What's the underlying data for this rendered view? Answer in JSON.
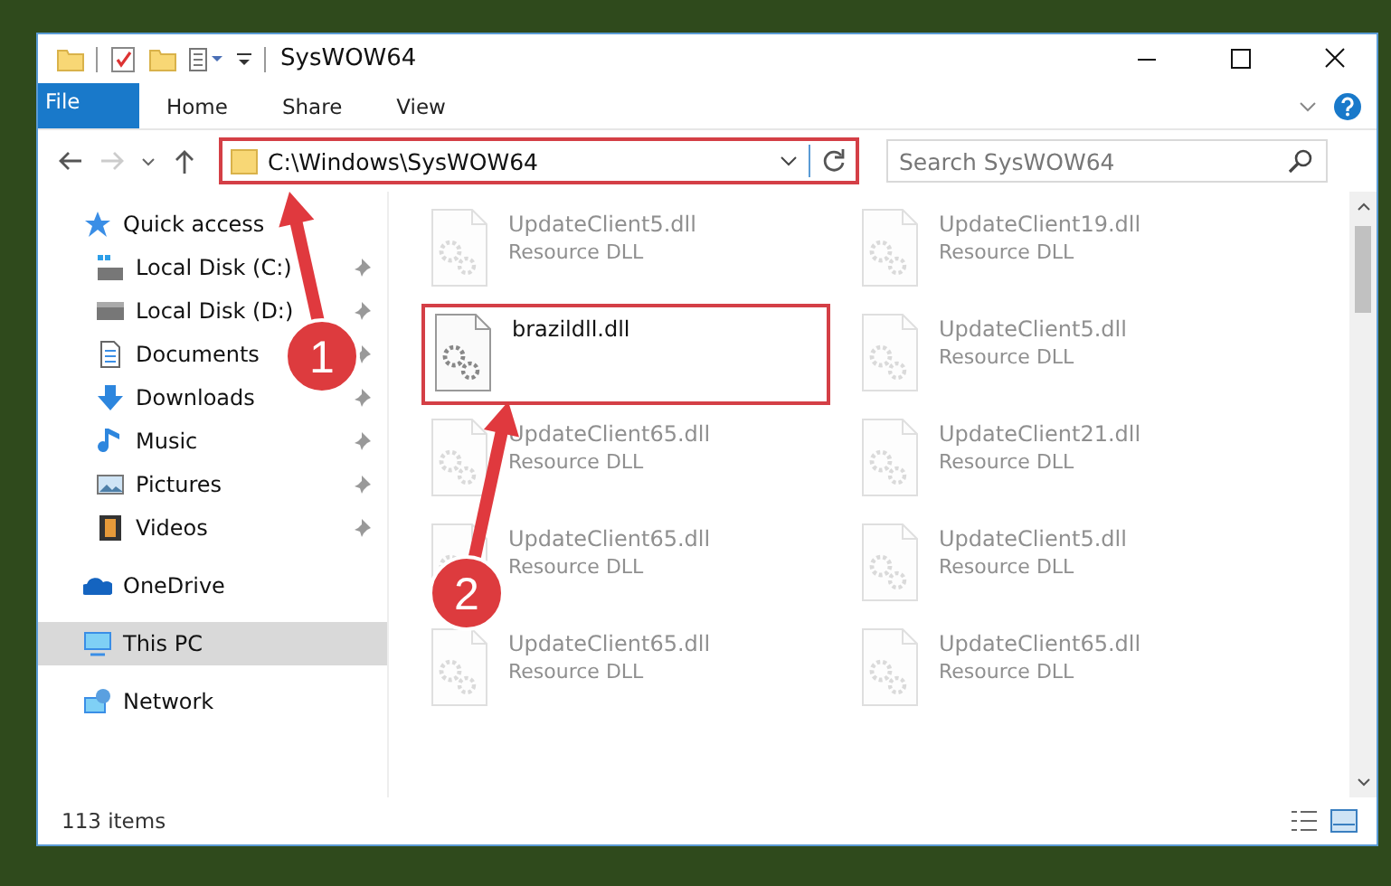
{
  "window": {
    "title": "SysWOW64"
  },
  "ribbon_tabs": [
    {
      "label": "File",
      "kind": "file"
    },
    {
      "label": "Home",
      "kind": "tab"
    },
    {
      "label": "Share",
      "kind": "tab"
    },
    {
      "label": "View",
      "kind": "tab"
    }
  ],
  "address_bar": {
    "path": "C:\\Windows\\SysWOW64",
    "highlighted": true
  },
  "search": {
    "placeholder": "Search SysWOW64"
  },
  "sidebar": {
    "items": [
      {
        "label": "Quick access",
        "selected": false,
        "children": [
          {
            "label": "Local Disk (C:)",
            "pinned": true
          },
          {
            "label": "Local Disk (D:)",
            "pinned": true
          },
          {
            "label": "Documents",
            "pinned": true
          },
          {
            "label": "Downloads",
            "pinned": true
          },
          {
            "label": "Music",
            "pinned": true
          },
          {
            "label": "Pictures",
            "pinned": true
          },
          {
            "label": "Videos",
            "pinned": true
          }
        ]
      },
      {
        "label": "OneDrive",
        "selected": false
      },
      {
        "label": "This PC",
        "selected": true
      },
      {
        "label": "Network",
        "selected": false
      }
    ]
  },
  "files": [
    {
      "name": "UpdateClient5.dll",
      "type": "Resource DLL",
      "kind": "faded"
    },
    {
      "name": "UpdateClient19.dll",
      "type": "Resource DLL",
      "kind": "faded"
    },
    {
      "name": "brazildll.dll",
      "kind": "highlighted"
    },
    {
      "name": "UpdateClient5.dll",
      "type": "Resource DLL",
      "kind": "faded"
    },
    {
      "name": "UpdateClient65.dll",
      "type": "Resource DLL",
      "kind": "faded"
    },
    {
      "name": "UpdateClient21.dll",
      "type": "Resource DLL",
      "kind": "faded"
    },
    {
      "name": "UpdateClient65.dll",
      "type": "Resource DLL",
      "kind": "faded"
    },
    {
      "name": "UpdateClient5.dll",
      "type": "Resource DLL",
      "kind": "faded"
    },
    {
      "name": "UpdateClient65.dll",
      "type": "Resource DLL",
      "kind": "faded"
    },
    {
      "name": "UpdateClient65.dll",
      "type": "Resource DLL",
      "kind": "faded"
    }
  ],
  "status_bar": {
    "item_count": "113 items"
  },
  "annotations": [
    {
      "label": "1"
    },
    {
      "label": "2"
    }
  ]
}
